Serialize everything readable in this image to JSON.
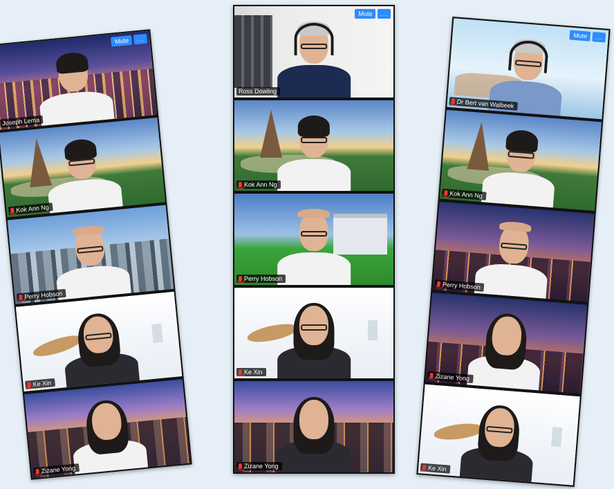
{
  "strips": [
    {
      "tiles": [
        {
          "name": "Joseph Lema",
          "scene": "lasvegas",
          "speaking": true,
          "controls": {
            "mute": "Mute",
            "more": "..."
          },
          "person": {
            "hair": "short",
            "body": "white",
            "glasses": false,
            "headset": false
          }
        },
        {
          "name": "Kok Ann Ng",
          "scene": "temple",
          "speaking": false,
          "controls": null,
          "person": {
            "hair": "short",
            "body": "white",
            "glasses": true,
            "headset": false
          }
        },
        {
          "name": "Perry Hobson",
          "scene": "city",
          "speaking": false,
          "controls": null,
          "person": {
            "hair": "bald",
            "body": "white",
            "glasses": true,
            "headset": false
          }
        },
        {
          "name": "Ke Xin",
          "scene": "travel",
          "speaking": false,
          "controls": null,
          "person": {
            "hair": "long",
            "body": "dark",
            "glasses": true,
            "headset": false
          }
        },
        {
          "name": "Zizane Yong",
          "scene": "sunset",
          "speaking": false,
          "controls": null,
          "person": {
            "hair": "long",
            "body": "white",
            "glasses": false,
            "headset": false
          }
        }
      ]
    },
    {
      "tiles": [
        {
          "name": "Ross Dowling",
          "scene": "office",
          "speaking": true,
          "controls": {
            "mute": "Mute",
            "more": "..."
          },
          "person": {
            "hair": "gray",
            "body": "navy",
            "glasses": true,
            "headset": true
          }
        },
        {
          "name": "Kok Ann Ng",
          "scene": "temple",
          "speaking": false,
          "controls": null,
          "person": {
            "hair": "short",
            "body": "white",
            "glasses": true,
            "headset": false
          }
        },
        {
          "name": "Perry Hobson",
          "scene": "stadium",
          "speaking": false,
          "controls": null,
          "person": {
            "hair": "bald",
            "body": "white",
            "glasses": true,
            "headset": false
          }
        },
        {
          "name": "Ke Xin",
          "scene": "travel",
          "speaking": false,
          "controls": null,
          "person": {
            "hair": "long",
            "body": "dark",
            "glasses": true,
            "headset": false
          }
        },
        {
          "name": "Zizane Yong",
          "scene": "sunset",
          "speaking": false,
          "controls": null,
          "person": {
            "hair": "long",
            "body": "dark",
            "glasses": false,
            "headset": false
          }
        }
      ]
    },
    {
      "tiles": [
        {
          "name": "Dr Bert van Walbeek",
          "scene": "sky",
          "speaking": false,
          "controls": {
            "mute": "Mute",
            "more": "..."
          },
          "person": {
            "hair": "gray",
            "body": "blue",
            "glasses": true,
            "headset": true
          }
        },
        {
          "name": "Kok Ann Ng",
          "scene": "temple",
          "speaking": false,
          "controls": null,
          "person": {
            "hair": "short",
            "body": "white",
            "glasses": true,
            "headset": false
          }
        },
        {
          "name": "Perry Hobson",
          "scene": "night",
          "speaking": false,
          "controls": null,
          "person": {
            "hair": "bald",
            "body": "white",
            "glasses": true,
            "headset": false
          }
        },
        {
          "name": "Zizane Yong",
          "scene": "night",
          "speaking": false,
          "controls": null,
          "person": {
            "hair": "long",
            "body": "white",
            "glasses": false,
            "headset": false
          }
        },
        {
          "name": "Ke Xin",
          "scene": "travel",
          "speaking": false,
          "controls": null,
          "person": {
            "hair": "long",
            "body": "dark",
            "glasses": true,
            "headset": false
          }
        }
      ]
    }
  ],
  "colors": {
    "background": "#e6eff7",
    "mute_button": "#2d8cff",
    "speaker_highlight": "#c6e04c",
    "mic_muted": "#e53935"
  },
  "icons": {
    "mic": "mic-muted-icon"
  }
}
